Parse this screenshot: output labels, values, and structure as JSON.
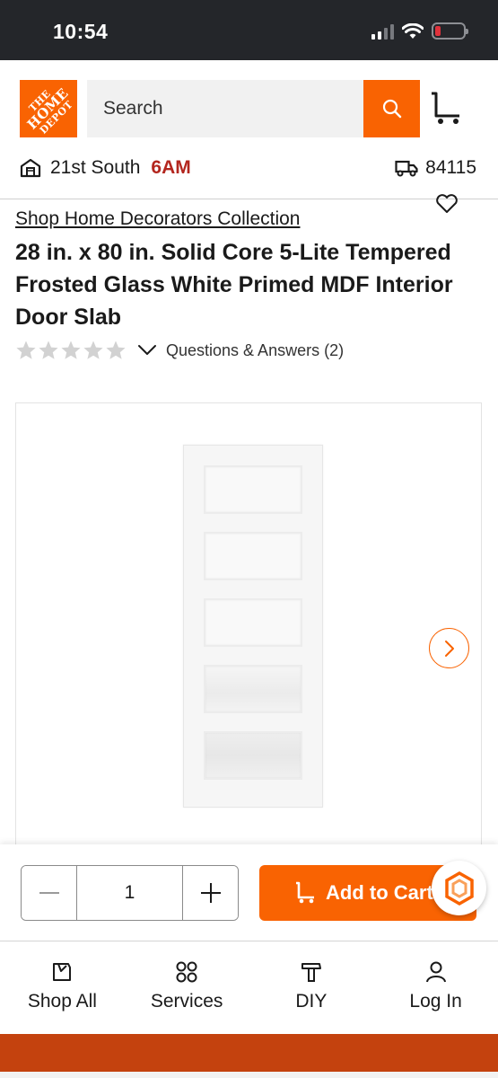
{
  "status_bar": {
    "time": "10:54",
    "icons": [
      "signal-icon",
      "wifi-icon",
      "battery-icon"
    ]
  },
  "header": {
    "logo_text_line1": "THE",
    "logo_text_line2": "HOME",
    "logo_text_line3": "DEPOT",
    "search": {
      "placeholder": "Search"
    },
    "store": {
      "name": "21st South",
      "hours": "6AM"
    },
    "delivery": {
      "zip": "84115"
    }
  },
  "product": {
    "brand_link": "Shop Home Decorators Collection",
    "title": "28 in. x 80 in. Solid Core 5-Lite Tempered Frosted Glass White Primed MDF Interior Door Slab",
    "rating": 0,
    "qa_link": "Questions & Answers (2)"
  },
  "cart_bar": {
    "quantity": "1",
    "add_to_cart_label": "Add to Cart"
  },
  "bottom_nav": [
    {
      "label": "Shop All",
      "icon": "shop-all-icon"
    },
    {
      "label": "Services",
      "icon": "services-icon"
    },
    {
      "label": "DIY",
      "icon": "diy-icon"
    },
    {
      "label": "Log In",
      "icon": "user-icon"
    }
  ],
  "colors": {
    "brand_orange": "#f96302",
    "status_bar": "#24262a",
    "hours_red": "#b3261e",
    "bottom_strip": "#c4420e"
  }
}
